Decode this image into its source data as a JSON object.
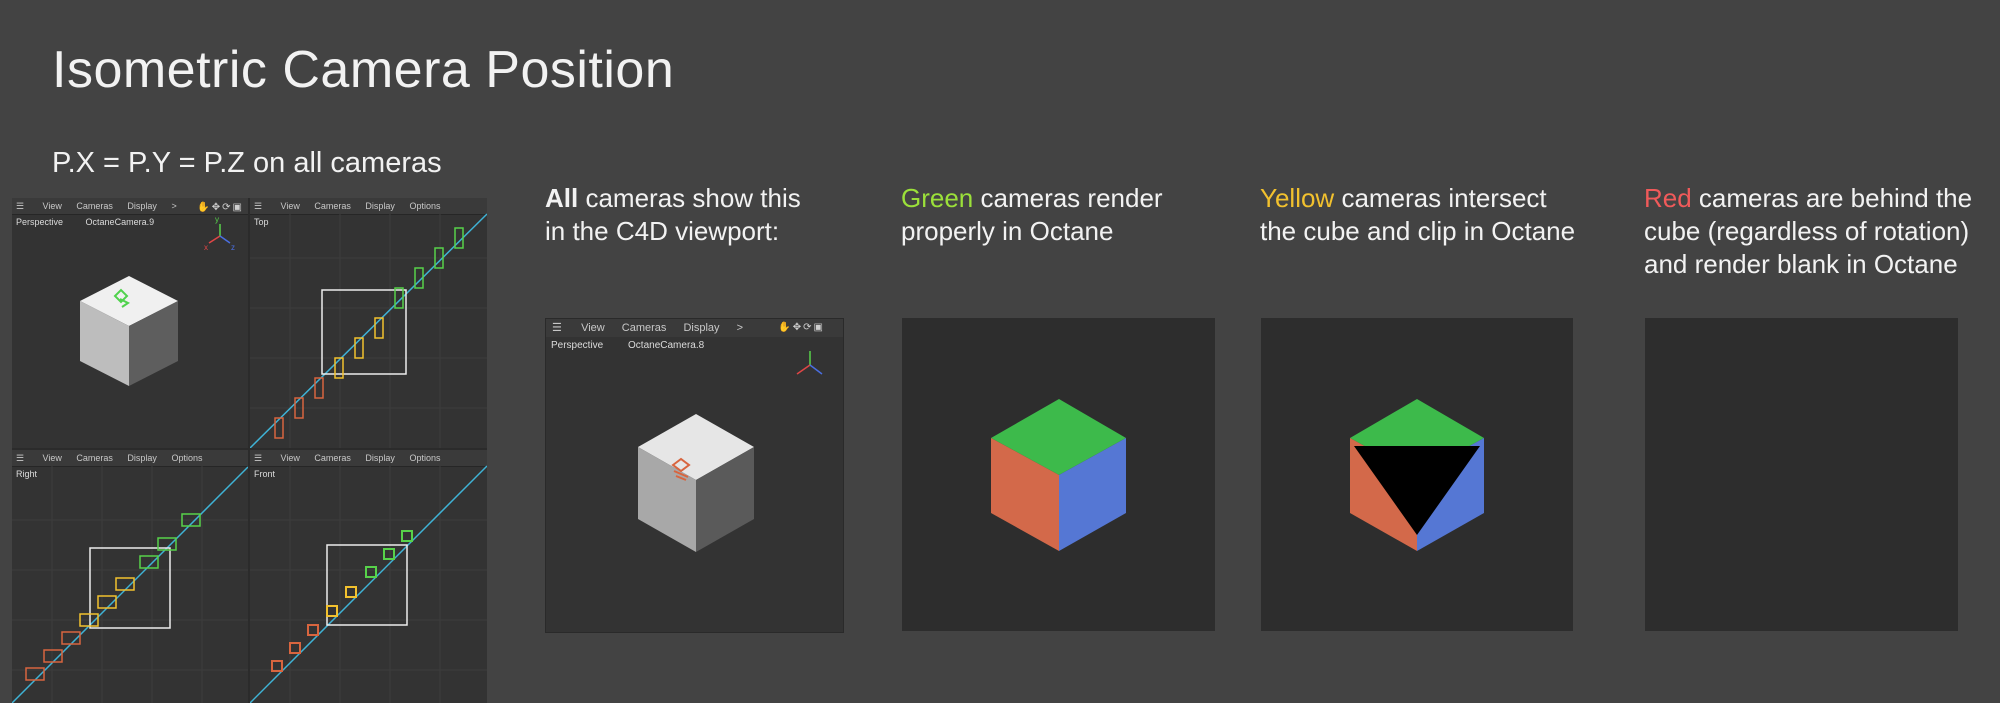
{
  "title": "Isometric Camera Position",
  "subtitle": "P.X = P.Y = P.Z on all cameras",
  "viewport": {
    "menu_view": "View",
    "menu_cameras": "Cameras",
    "menu_display": "Display",
    "menu_options": "Options",
    "menu_more": ">",
    "pane_perspective": "Perspective",
    "pane_camera_name": "OctaneCamera.9",
    "pane_top": "Top",
    "pane_right": "Right",
    "pane_front": "Front",
    "axis_x": "x",
    "axis_y": "y",
    "axis_z": "z"
  },
  "captions": {
    "all": {
      "highlight": "All",
      "rest_line1": " cameras show this",
      "line2": "in the C4D viewport:"
    },
    "green": {
      "highlight": "Green",
      "rest_line1": " cameras render",
      "line2": "properly in Octane"
    },
    "yellow": {
      "highlight": "Yellow",
      "rest_line1": " cameras intersect",
      "line2": "the cube and clip in Octane"
    },
    "red": {
      "highlight": "Red",
      "rest_line1": " cameras are behind the",
      "line2": "cube (regardless of rotation)",
      "line3": "and render blank in Octane"
    }
  },
  "c4d_view": {
    "menu_view": "View",
    "menu_cameras": "Cameras",
    "menu_display": "Display",
    "menu_more": ">",
    "pane_perspective": "Perspective",
    "camera_name": "OctaneCamera.8"
  },
  "colors": {
    "background": "#434343",
    "green": "#9be03a",
    "yellow": "#f2c12e",
    "red": "#f05a5a",
    "cube_top": "#3dba4b",
    "cube_left": "#d3694a",
    "cube_right": "#5577d4"
  }
}
